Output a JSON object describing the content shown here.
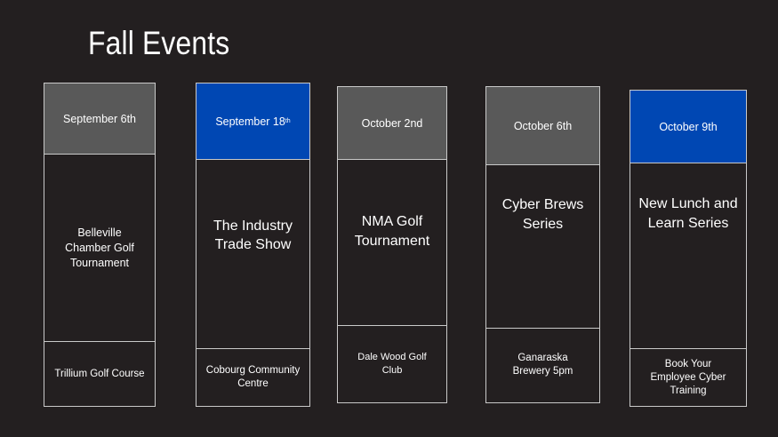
{
  "title": "Fall Events",
  "events": [
    {
      "date": "September 6th",
      "name": "Belleville Chamber Golf Tournament",
      "venue": "Trillium Golf Course",
      "highlight": "#595959"
    },
    {
      "date": "September 18",
      "date_suffix": "th",
      "name": "The Industry Trade Show",
      "venue": "Cobourg Community Centre",
      "highlight": "#0047b3"
    },
    {
      "date": "October 2nd",
      "name": "NMA Golf Tournament",
      "venue": "Dale Wood Golf Club",
      "highlight": "#595959"
    },
    {
      "date": "October 6th",
      "name": "Cyber Brews Series",
      "venue": "Ganaraska Brewery 5pm",
      "highlight": "#595959"
    },
    {
      "date": "October 9th",
      "name": "New Lunch and Learn Series",
      "venue": "Book Your Employee Cyber Training",
      "highlight": "#0047b3"
    }
  ]
}
